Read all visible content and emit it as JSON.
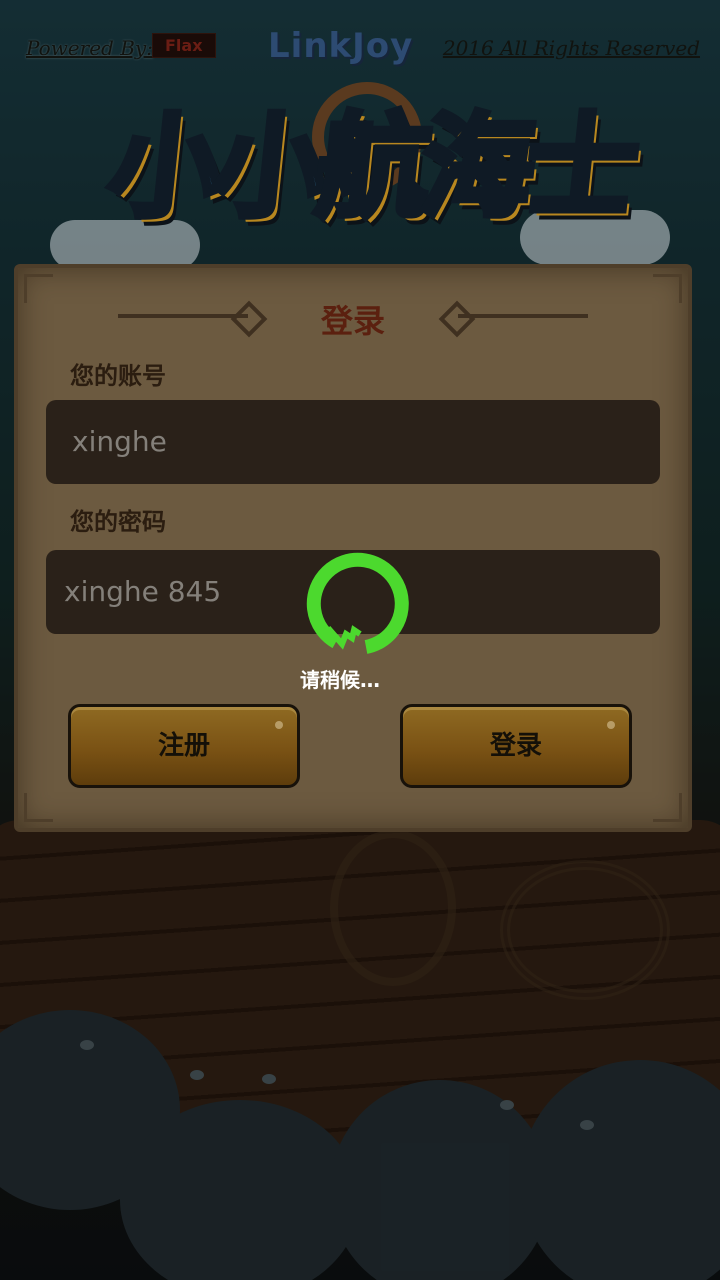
{
  "header": {
    "powered_by": "Powered By:",
    "engine": "Flax",
    "publisher": "LinkJoy",
    "copyright": "2016 All Rights Reserved"
  },
  "logo": {
    "title": "小小航海士"
  },
  "login_panel": {
    "title": "登录",
    "account_label": "您的账号",
    "account_value": "xinghe",
    "password_label": "您的密码",
    "password_value": "xinghe 845",
    "register_button": "注册",
    "login_button": "登录"
  },
  "loading": {
    "text": "请稍候…",
    "color": "#4cd92e"
  }
}
